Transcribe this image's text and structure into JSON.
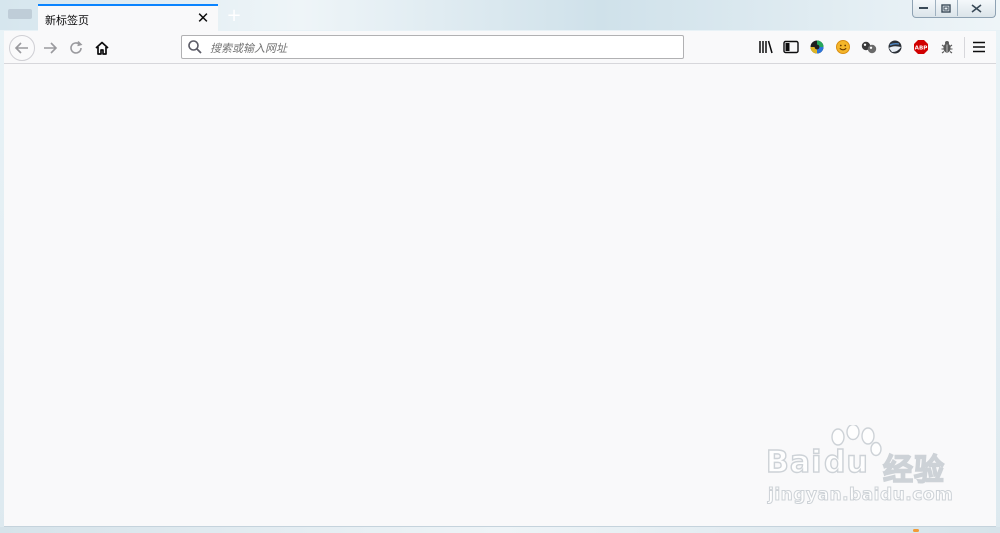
{
  "window": {
    "controls": {
      "minimize": "minimize-icon",
      "restore": "restore-icon",
      "close": "close-icon"
    }
  },
  "tabs": [
    {
      "title": "新标签页",
      "active": true
    }
  ],
  "tab_close_symbol": "✕",
  "new_tab_symbol": "+",
  "navbar": {
    "urlbar": {
      "placeholder": "搜索或输入网址",
      "value": ""
    },
    "toolbar_icons": [
      "library-icon",
      "sidebar-icon",
      "color-wheel-extension-icon",
      "smiley-extension-icon",
      "ball-extension-icon",
      "earth-extension-icon",
      "adblock-plus-icon",
      "bug-extension-icon",
      "hamburger-menu-icon"
    ],
    "adblock_label": "ABP"
  },
  "watermark": {
    "brand_latin": "Bai",
    "brand_du": "du",
    "brand_cn": "经验",
    "url": "jingyan.baidu.com"
  },
  "colors": {
    "accent_tab": "#0a84ff",
    "content_bg": "#f9f9fa",
    "abp_red": "#d10000"
  }
}
